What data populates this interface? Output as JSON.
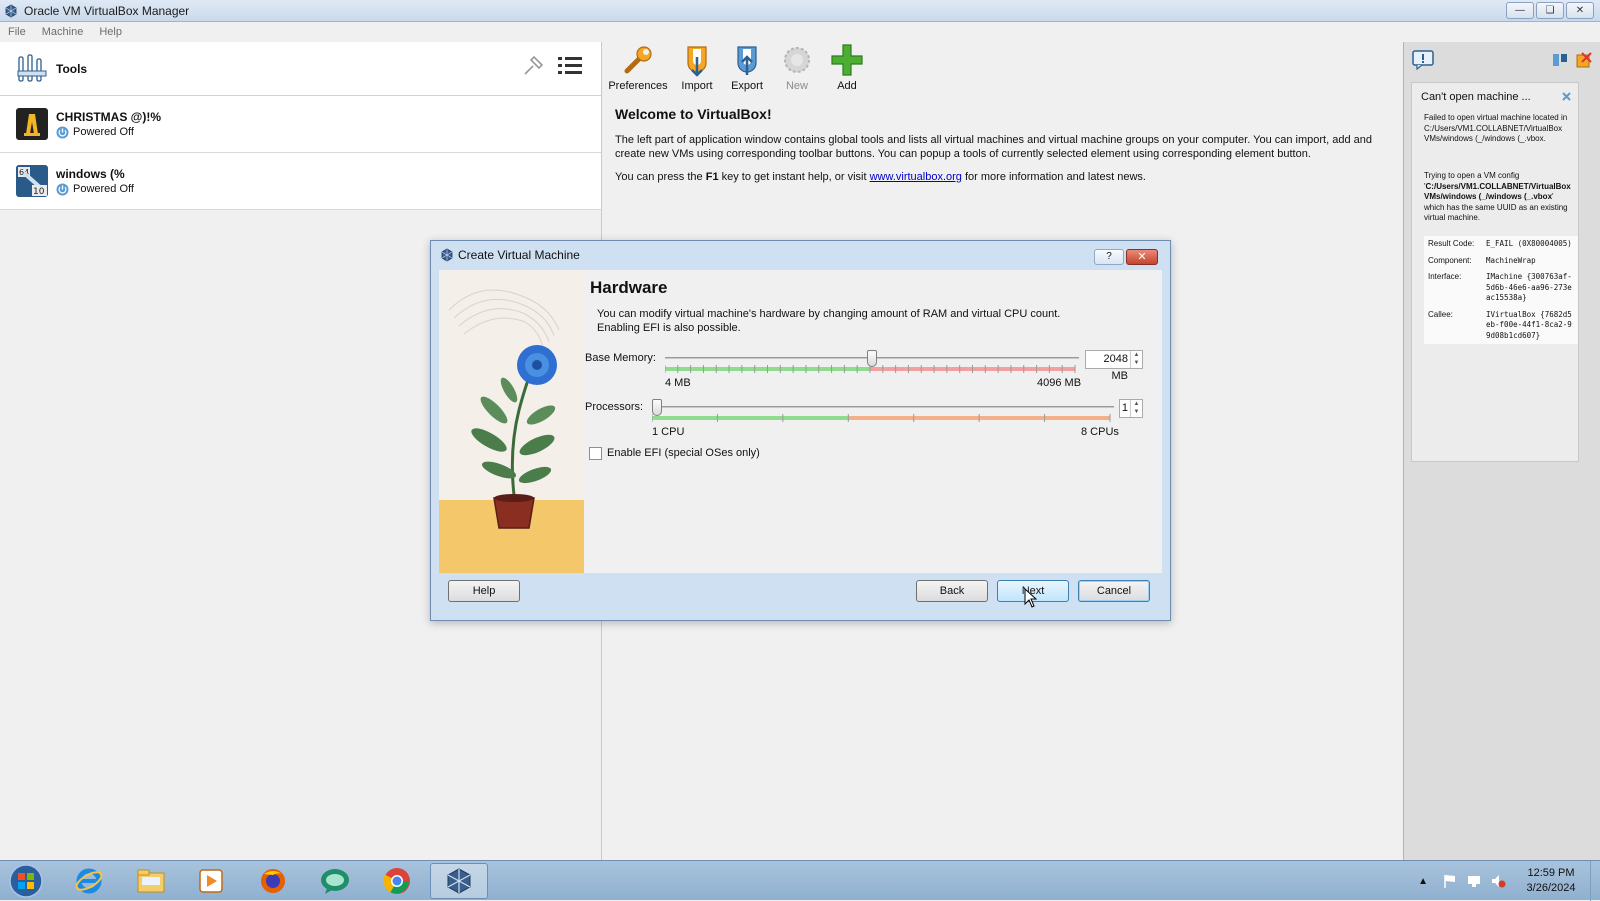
{
  "window": {
    "title": "Oracle VM VirtualBox Manager",
    "controls": [
      "minimize",
      "restore",
      "close"
    ]
  },
  "menu": [
    "File",
    "Machine",
    "Help"
  ],
  "left": {
    "tools_label": "Tools",
    "vms": [
      {
        "name": "CHRISTMAS @)!%",
        "state": "Powered Off"
      },
      {
        "name": "windows (%",
        "state": "Powered Off"
      }
    ]
  },
  "toolbar": {
    "preferences": "Preferences",
    "import": "Import",
    "export": "Export",
    "new": "New",
    "add": "Add"
  },
  "welcome": {
    "title": "Welcome to VirtualBox!",
    "p1": "The left part of application window contains global tools and lists all virtual machines and virtual machine groups on your computer. You can import, add and create new VMs using corresponding toolbar buttons. You can popup a tools of currently selected element using corresponding element button.",
    "p2_before": "You can press the ",
    "p2_key": "F1",
    "p2_mid": " key to get instant help, or visit ",
    "p2_link": "www.virtualbox.org",
    "p2_after": " for more information and latest news."
  },
  "notification": {
    "title": "Can't open machine ...",
    "text1": "Failed to open virtual machine located in C:/Users/VM1.COLLABNET/VirtualBox VMs/windows (_/windows (_.vbox.",
    "text2_prefix": "Trying to open a VM config '",
    "text2_bold": "C:/Users/VM1.COLLABNET/VirtualBox VMs/windows (_/windows (_.vbox",
    "text2_suffix": "' which has the same UUID as an existing virtual machine.",
    "details": [
      {
        "key": "Result Code:",
        "value": "E_FAIL (0X80004005)"
      },
      {
        "key": "Component:",
        "value": "MachineWrap"
      },
      {
        "key": "Interface:",
        "value": "IMachine {300763af-5d6b-46e6-aa96-273eac15538a}"
      },
      {
        "key": "Callee:",
        "value": "IVirtualBox {7682d5eb-f00e-44f1-8ca2-99d08b1cd607}"
      }
    ]
  },
  "dialog": {
    "title": "Create Virtual Machine",
    "help_glyph": "?",
    "close_glyph": "✕",
    "heading": "Hardware",
    "desc_line1": "You can modify virtual machine's hardware by changing amount of RAM and virtual CPU count.",
    "desc_line2": "Enabling EFI is also possible.",
    "memory": {
      "label": "Base Memory:",
      "value": "2048 MB",
      "min": "4 MB",
      "max": "4096 MB",
      "fraction": 0.5
    },
    "processors": {
      "label": "Processors:",
      "value": "1",
      "min": "1 CPU",
      "max": "8 CPUs",
      "fraction": 0.0
    },
    "efi": {
      "label": "Enable EFI (special OSes only)",
      "checked": false
    },
    "buttons": {
      "help": "Help",
      "back": "Back",
      "next": "Next",
      "cancel": "Cancel"
    }
  },
  "taskbar": {
    "apps": [
      "start",
      "internet-explorer",
      "file-explorer",
      "media-player",
      "firefox",
      "chat-app",
      "chrome",
      "virtualbox"
    ],
    "time": "12:59 PM",
    "date": "3/26/2024"
  },
  "colors": {
    "accent": "#3c7fb1",
    "slider_green": "#8fdc8f",
    "slider_red": "#f0a0a0",
    "slider_orange": "#f3b08a"
  }
}
